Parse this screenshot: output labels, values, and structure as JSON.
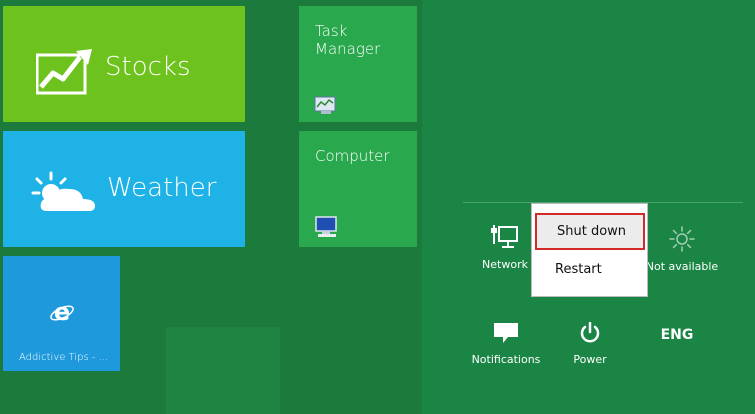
{
  "tiles": {
    "stocks": "Stocks",
    "weather": "Weather",
    "addictive_tips": "Addictive Tips - ...",
    "task_manager": "Task Manager",
    "computer": "Computer"
  },
  "settings": {
    "network": "Network",
    "brightness": "Not available",
    "notifications": "Notifications",
    "power": "Power",
    "keyboard": "ENG"
  },
  "power_menu": {
    "shutdown": "Shut down",
    "restart": "Restart"
  },
  "icons": {
    "stocks": "stocks-chart-icon",
    "weather": "weather-sun-cloud-icon",
    "addictive_tips": "internet-explorer-icon",
    "task_manager": "task-manager-icon",
    "computer": "computer-monitor-icon",
    "network": "network-icon",
    "brightness": "brightness-icon",
    "notifications": "notifications-icon",
    "power": "power-icon"
  },
  "colors": {
    "stocks_tile": "#6ec21d",
    "weather_tile": "#1fb2e6",
    "addictive_tile": "#1e9adc",
    "app_tile": "#29a84e",
    "start_background": "#1b7a3c",
    "settings_pane": "#1a8544",
    "menu_highlight_border": "#d22a2a"
  }
}
